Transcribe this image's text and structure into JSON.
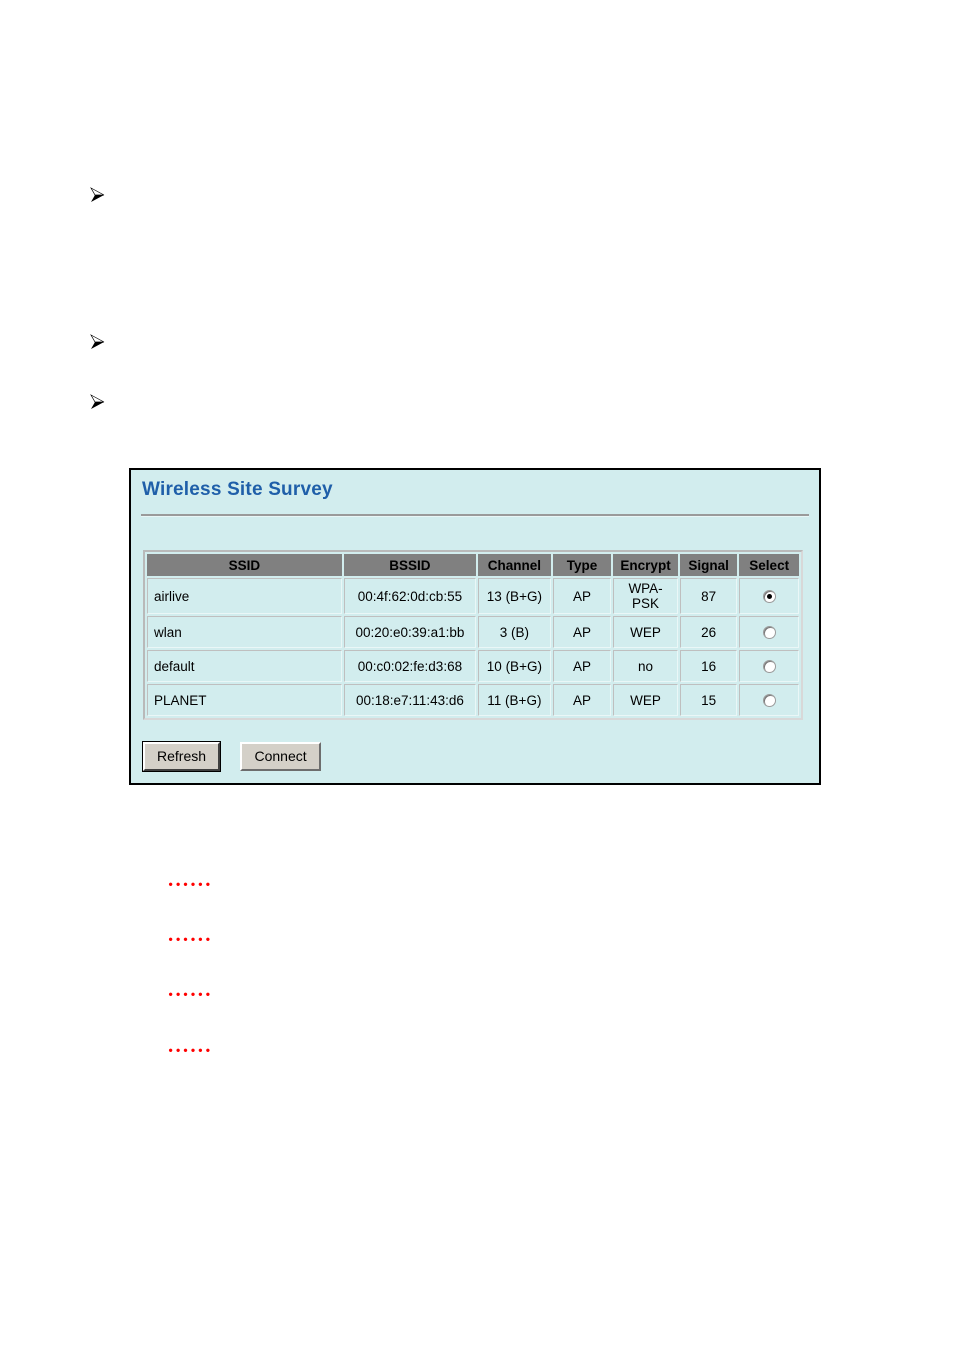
{
  "document": {
    "bullets": [
      {
        "glyph": "arrow-bullet"
      },
      {
        "glyph": "arrow-bullet"
      },
      {
        "glyph": "arrow-bullet"
      }
    ],
    "placeholder_rows": [
      {
        "text": "......"
      },
      {
        "text": "......"
      },
      {
        "text": "......"
      },
      {
        "text": "......"
      }
    ],
    "placeholder_color": "#ff0000"
  },
  "panel": {
    "title": "Wireless Site Survey",
    "title_color": "#1f5fa9",
    "background_color": "#d2edee",
    "border_color": "#000000"
  },
  "table": {
    "header_background": "#808080",
    "columns": [
      "SSID",
      "BSSID",
      "Channel",
      "Type",
      "Encrypt",
      "Signal",
      "Select"
    ],
    "rows": [
      {
        "ssid": "airlive",
        "bssid": "00:4f:62:0d:cb:55",
        "channel": "13 (B+G)",
        "type": "AP",
        "encrypt": "WPA-PSK",
        "signal": "87",
        "selected": true
      },
      {
        "ssid": "wlan",
        "bssid": "00:20:e0:39:a1:bb",
        "channel": "3 (B)",
        "type": "AP",
        "encrypt": "WEP",
        "signal": "26",
        "selected": false
      },
      {
        "ssid": "default",
        "bssid": "00:c0:02:fe:d3:68",
        "channel": "10 (B+G)",
        "type": "AP",
        "encrypt": "no",
        "signal": "16",
        "selected": false
      },
      {
        "ssid": "PLANET",
        "bssid": "00:18:e7:11:43:d6",
        "channel": "11 (B+G)",
        "type": "AP",
        "encrypt": "WEP",
        "signal": "15",
        "selected": false
      }
    ]
  },
  "buttons": {
    "refresh_label": "Refresh",
    "connect_label": "Connect"
  }
}
